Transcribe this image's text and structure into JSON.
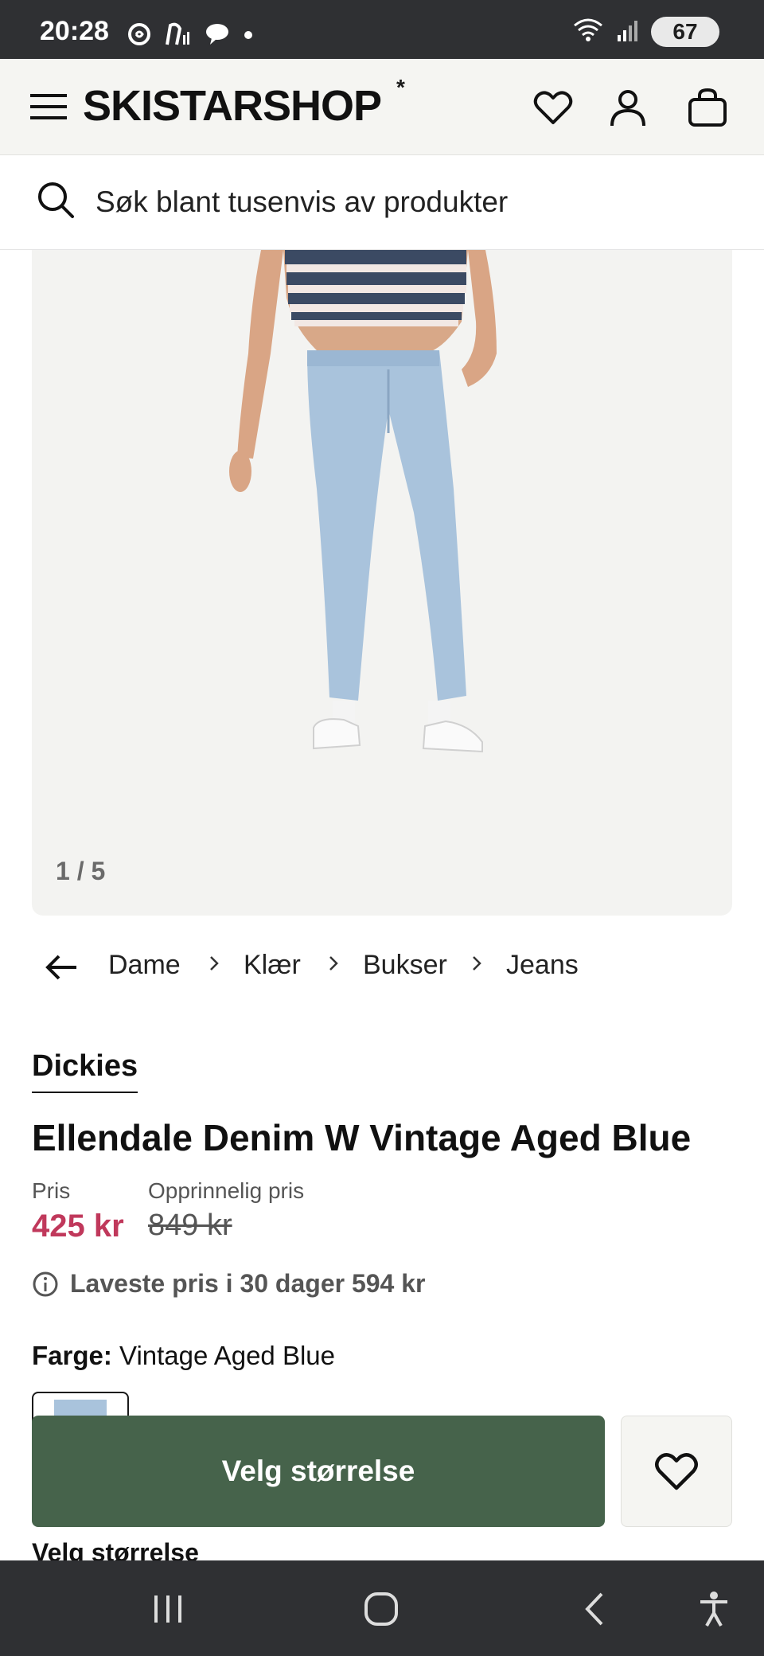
{
  "status_bar": {
    "time": "20:28",
    "battery": "67",
    "icons": [
      "threads-icon",
      "accessibility-notification-icon",
      "chat-bubble-icon",
      "dot-icon",
      "wifi-icon",
      "signal-icon"
    ]
  },
  "header": {
    "logo": "SKISTARSHOP",
    "logo_mark": "*",
    "icons": [
      "menu-icon",
      "heart-icon",
      "user-icon",
      "bag-icon"
    ]
  },
  "search": {
    "placeholder": "Søk blant tusenvis av produkter"
  },
  "gallery": {
    "counter": "1 / 5",
    "image_description_colors": {
      "background": "#f3f3f1",
      "denim": "#a9c3dc"
    }
  },
  "breadcrumb": {
    "items": [
      "Dame",
      "Klær",
      "Bukser",
      "Jeans"
    ]
  },
  "product": {
    "brand": "Dickies",
    "title": "Ellendale Denim W Vintage Aged Blue",
    "price_label": "Pris",
    "price": "425 kr",
    "original_price_label": "Opprinnelig pris",
    "original_price": "849 kr",
    "lowest_price_note": "Laveste pris i 30 dager 594 kr",
    "color_label": "Farge:",
    "color_value": "Vintage Aged Blue",
    "size_heading": "Velg størrelse"
  },
  "actions": {
    "select_size_button": "Velg størrelse"
  },
  "colors": {
    "accent_green": "#46634b",
    "sale_red": "#c0385b",
    "header_bg": "#f5f5f2",
    "system_bar": "#2f3033"
  }
}
